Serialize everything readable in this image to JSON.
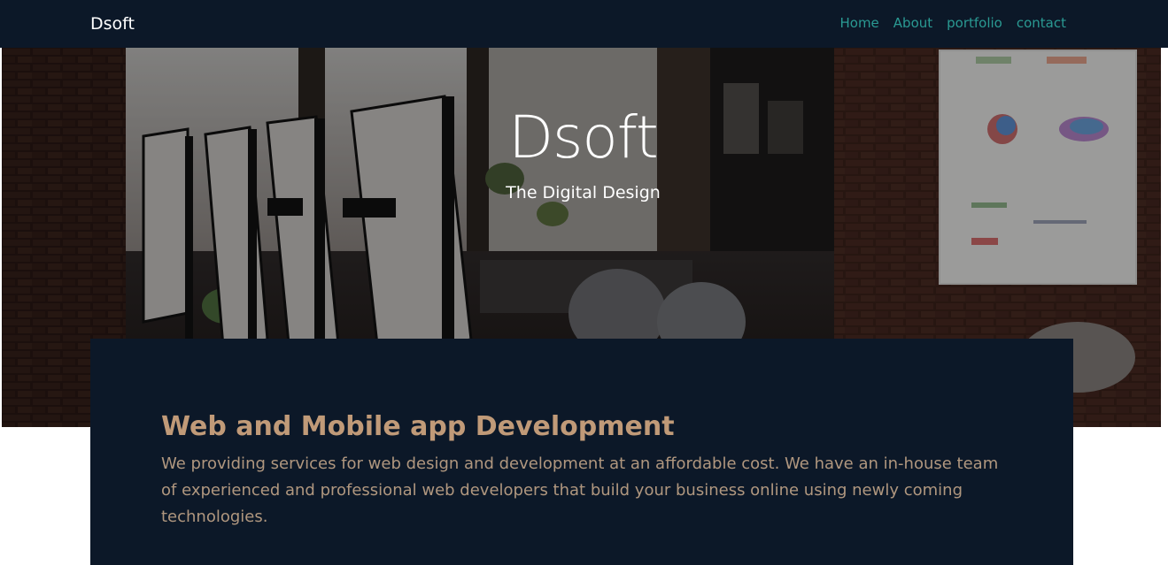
{
  "navbar": {
    "brand": "Dsoft",
    "links": [
      "Home",
      "About",
      "portfolio",
      "contact"
    ]
  },
  "hero": {
    "title": "Dsoft",
    "subtitle": "The Digital Design",
    "background_description": "blurred office with computer monitors"
  },
  "service": {
    "title": "Web and Mobile app Development",
    "text": "We providing services for web design and development at an affordable cost. We have an in-house team of experienced and professional web developers that build your business online using newly coming technologies."
  },
  "colors": {
    "navbar_bg": "#0c1828",
    "brand": "#ffffff",
    "nav_link": "#2a9a93",
    "card_bg": "#0c1828",
    "heading": "#c09a78",
    "body_text": "#b0977f"
  }
}
